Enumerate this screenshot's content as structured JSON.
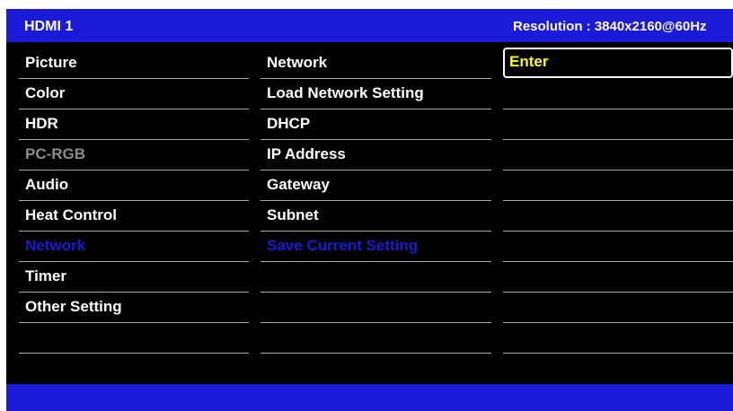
{
  "header": {
    "source": "HDMI 1",
    "resolution": "Resolution : 3840x2160@60Hz"
  },
  "main_menu": [
    {
      "label": "Picture",
      "state": "normal"
    },
    {
      "label": "Color",
      "state": "normal"
    },
    {
      "label": "HDR",
      "state": "normal"
    },
    {
      "label": "PC-RGB",
      "state": "disabled"
    },
    {
      "label": "Audio",
      "state": "normal"
    },
    {
      "label": "Heat Control",
      "state": "normal"
    },
    {
      "label": "Network",
      "state": "selected"
    },
    {
      "label": "Timer",
      "state": "normal"
    },
    {
      "label": "Other Setting",
      "state": "normal"
    },
    {
      "label": "",
      "state": "empty"
    }
  ],
  "sub_menu": [
    {
      "label": "Network",
      "state": "normal"
    },
    {
      "label": "Load Network Setting",
      "state": "normal"
    },
    {
      "label": "DHCP",
      "state": "normal"
    },
    {
      "label": "IP Address",
      "state": "normal"
    },
    {
      "label": "Gateway",
      "state": "normal"
    },
    {
      "label": "Subnet",
      "state": "normal"
    },
    {
      "label": "Save Current Setting",
      "state": "selected"
    },
    {
      "label": "",
      "state": "empty"
    },
    {
      "label": "",
      "state": "empty"
    },
    {
      "label": "",
      "state": "empty"
    }
  ],
  "value_column": [
    {
      "label": "Enter",
      "state": "focused"
    },
    {
      "label": "",
      "state": "empty"
    },
    {
      "label": "",
      "state": "empty"
    },
    {
      "label": "",
      "state": "empty"
    },
    {
      "label": "",
      "state": "empty"
    },
    {
      "label": "",
      "state": "empty"
    },
    {
      "label": "",
      "state": "empty"
    },
    {
      "label": "",
      "state": "empty"
    },
    {
      "label": "",
      "state": "empty"
    },
    {
      "label": "",
      "state": "empty"
    }
  ],
  "colors": {
    "bar_blue": "#1a1ad8",
    "background": "#000000",
    "text": "#ffffff",
    "disabled_text": "#8c8c8c",
    "selected_text": "#1a1ad8",
    "focus_text": "#ffff00"
  }
}
